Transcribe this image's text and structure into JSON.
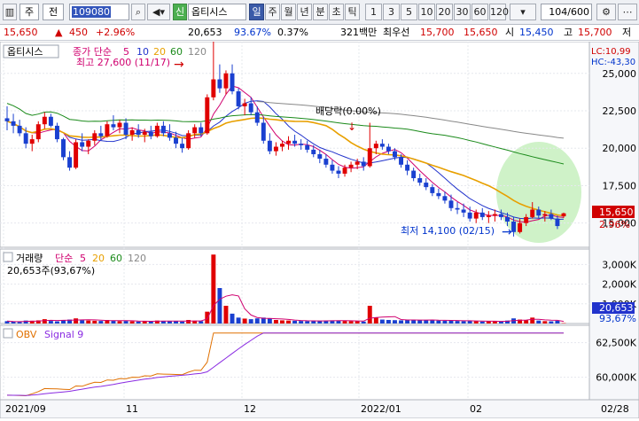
{
  "toolbar": {
    "type_label": "주",
    "type2_label": "전",
    "code_value": "109080",
    "credit_badge": "신",
    "stock_name": "옵티시스",
    "periods": [
      "일",
      "주",
      "월",
      "년",
      "분",
      "초",
      "틱"
    ],
    "active_period_index": 0,
    "intervals": [
      "1",
      "3",
      "5",
      "10",
      "20",
      "30",
      "60",
      "120"
    ],
    "count_value": "104",
    "count_total": "/600"
  },
  "info": {
    "price": "15,650",
    "change": "450",
    "change_pct": "+2.96%",
    "volume": "20,653",
    "vol_ratio": "93.67%",
    "turnover": "0.37%",
    "amount": "321백만",
    "best_ask_label": "최우선",
    "best_ask": "15,700",
    "best_bid": "15,650",
    "open_label": "시",
    "open": "15,450",
    "high_label": "고",
    "high": "15,700",
    "low_label": "저",
    "low": "15,"
  },
  "price_panel": {
    "legend_name": "옵티시스",
    "ma_label": "종가 단순",
    "ma_periods": [
      "5",
      "10",
      "20",
      "60",
      "120"
    ],
    "ma_colors": [
      "#d0006f",
      "#2233cc",
      "#e8a000",
      "#1a8a1a",
      "#888888"
    ],
    "max_label": "최고 27,600 (11/17)",
    "min_label": "최저 14,100 (02/15)",
    "dividend_label": "배당락(0.00%)",
    "lc_label": "LC:10,99",
    "hc_label": "HC:-43,30",
    "y_ticks": [
      "25,000",
      "22,500",
      "20,000",
      "17,500",
      "15,000"
    ],
    "last_price_tag": "15,650",
    "last_pct_tag": "2.96%"
  },
  "volume_panel": {
    "legend": "거래량",
    "ma_label": "단순",
    "ma_periods": [
      "5",
      "20",
      "60",
      "120"
    ],
    "sub_label": "20,653주(93,67%)",
    "y_ticks": [
      "3,000K",
      "2,000K",
      "1,000K"
    ],
    "last_tag": "20,653",
    "last_pct_tag": "93,67%"
  },
  "obv_panel": {
    "legend": "OBV",
    "signal_label": "Signal 9",
    "y_ticks": [
      "62,500K",
      "60,000K"
    ]
  },
  "x_axis": [
    "2021/09",
    "11",
    "12",
    "2022/01",
    "02",
    "02/28"
  ],
  "chart_data": {
    "type": "candlestick",
    "price_ylim": [
      13500,
      27000
    ],
    "candles": [
      [
        22000,
        22800,
        21200,
        21800
      ],
      [
        21800,
        22300,
        21000,
        21500
      ],
      [
        21500,
        21900,
        20800,
        21000
      ],
      [
        21000,
        21400,
        20000,
        20300
      ],
      [
        20300,
        20900,
        19800,
        20600
      ],
      [
        20600,
        21800,
        20400,
        21600
      ],
      [
        21600,
        22400,
        21300,
        22100
      ],
      [
        22100,
        22300,
        21400,
        21500
      ],
      [
        21500,
        21700,
        20400,
        20600
      ],
      [
        20600,
        20700,
        19200,
        19400
      ],
      [
        19400,
        19800,
        18500,
        18700
      ],
      [
        18700,
        20600,
        18600,
        20400
      ],
      [
        20400,
        21000,
        19800,
        20100
      ],
      [
        20100,
        20600,
        19600,
        20500
      ],
      [
        20500,
        21200,
        20200,
        21000
      ],
      [
        21000,
        21500,
        20500,
        20800
      ],
      [
        20800,
        21800,
        20700,
        21600
      ],
      [
        21600,
        22200,
        21200,
        21400
      ],
      [
        21400,
        21900,
        21000,
        21700
      ],
      [
        21700,
        22000,
        20600,
        20900
      ],
      [
        20900,
        21400,
        20500,
        21200
      ],
      [
        21200,
        21600,
        20700,
        20900
      ],
      [
        20900,
        21300,
        20400,
        21100
      ],
      [
        21100,
        21500,
        20600,
        20800
      ],
      [
        20800,
        21700,
        20700,
        21500
      ],
      [
        21500,
        21800,
        20800,
        21000
      ],
      [
        21000,
        21600,
        20500,
        20700
      ],
      [
        20700,
        21100,
        20000,
        20300
      ],
      [
        20300,
        20700,
        19700,
        20000
      ],
      [
        20000,
        21200,
        19900,
        21000
      ],
      [
        21000,
        21600,
        20700,
        21400
      ],
      [
        21400,
        21700,
        20800,
        21000
      ],
      [
        21000,
        23600,
        20900,
        23400
      ],
      [
        23400,
        27600,
        23200,
        24600
      ],
      [
        24600,
        25600,
        23700,
        24000
      ],
      [
        24000,
        25200,
        23600,
        25000
      ],
      [
        25000,
        25600,
        23600,
        23800
      ],
      [
        23800,
        24000,
        22600,
        22800
      ],
      [
        22800,
        23300,
        22200,
        23000
      ],
      [
        23000,
        23400,
        22200,
        22400
      ],
      [
        22400,
        22800,
        21500,
        21700
      ],
      [
        21700,
        22100,
        20300,
        20500
      ],
      [
        20500,
        21000,
        19600,
        19800
      ],
      [
        19800,
        20400,
        19500,
        20100
      ],
      [
        20100,
        20500,
        19800,
        20300
      ],
      [
        20300,
        20800,
        19900,
        20500
      ],
      [
        20500,
        20900,
        20100,
        20300
      ],
      [
        20300,
        20600,
        19900,
        20200
      ],
      [
        20200,
        20500,
        19700,
        19900
      ],
      [
        19900,
        20200,
        19400,
        19600
      ],
      [
        19600,
        19900,
        19000,
        19300
      ],
      [
        19300,
        19600,
        18700,
        18900
      ],
      [
        18900,
        19200,
        18300,
        18500
      ],
      [
        18500,
        18800,
        18000,
        18300
      ],
      [
        18300,
        18900,
        18100,
        18700
      ],
      [
        18700,
        19100,
        18400,
        18900
      ],
      [
        18900,
        19300,
        18600,
        19100
      ],
      [
        19100,
        19400,
        18500,
        18800
      ],
      [
        18800,
        21700,
        18700,
        20000
      ],
      [
        20000,
        20500,
        19600,
        20300
      ],
      [
        20300,
        20600,
        19900,
        20100
      ],
      [
        20100,
        20300,
        19600,
        19800
      ],
      [
        19800,
        20000,
        19200,
        19400
      ],
      [
        19400,
        19600,
        18700,
        18900
      ],
      [
        18900,
        19200,
        18200,
        18500
      ],
      [
        18500,
        18700,
        17800,
        18000
      ],
      [
        18000,
        18300,
        17500,
        17700
      ],
      [
        17700,
        18000,
        17200,
        17400
      ],
      [
        17400,
        17600,
        16800,
        17000
      ],
      [
        17000,
        17300,
        16600,
        16800
      ],
      [
        16800,
        17100,
        16300,
        16500
      ],
      [
        16500,
        16900,
        15800,
        16000
      ],
      [
        16000,
        16400,
        15600,
        15900
      ],
      [
        15900,
        16300,
        15400,
        15700
      ],
      [
        15700,
        16100,
        15100,
        15300
      ],
      [
        15300,
        15900,
        15000,
        15700
      ],
      [
        15700,
        16000,
        15200,
        15400
      ],
      [
        15400,
        15800,
        15000,
        15500
      ],
      [
        15500,
        15900,
        15100,
        15600
      ],
      [
        15600,
        15900,
        15200,
        15400
      ],
      [
        15400,
        15700,
        14800,
        15100
      ],
      [
        15100,
        15400,
        14100,
        14400
      ],
      [
        14400,
        15300,
        14300,
        15000
      ],
      [
        15000,
        15600,
        14800,
        15400
      ],
      [
        15400,
        16400,
        15300,
        15900
      ],
      [
        15900,
        16100,
        15300,
        15500
      ],
      [
        15500,
        15800,
        15100,
        15600
      ],
      [
        15600,
        15900,
        15200,
        15300
      ],
      [
        15300,
        15500,
        14600,
        14800
      ],
      [
        15450,
        15700,
        15350,
        15650
      ]
    ],
    "volumes": [
      120,
      90,
      80,
      150,
      140,
      160,
      220,
      130,
      110,
      180,
      200,
      260,
      170,
      150,
      140,
      130,
      180,
      150,
      120,
      130,
      110,
      100,
      120,
      110,
      150,
      130,
      110,
      120,
      100,
      180,
      140,
      120,
      600,
      3500,
      1800,
      900,
      500,
      300,
      250,
      220,
      260,
      300,
      250,
      180,
      160,
      150,
      140,
      130,
      120,
      130,
      140,
      150,
      160,
      140,
      130,
      120,
      110,
      100,
      900,
      300,
      200,
      180,
      170,
      160,
      200,
      180,
      170,
      160,
      180,
      150,
      140,
      160,
      130,
      120,
      140,
      110,
      100,
      120,
      110,
      100,
      150,
      260,
      200,
      160,
      300,
      150,
      120,
      110,
      140,
      21
    ],
    "obv_ylim": [
      58500,
      63500
    ]
  }
}
